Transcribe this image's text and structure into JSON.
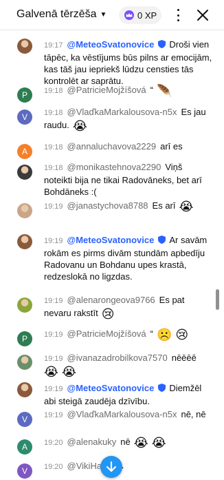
{
  "header": {
    "title": "Galvenā tērzēša",
    "xp_label": "0 XP",
    "xp_icon": "crown-icon",
    "menu_icon": "more-vert-icon",
    "close_icon": "close-icon",
    "accent": "#7c4dff"
  },
  "messages": [
    {
      "avatar_type": "photo",
      "avatar_color": "#8b5a3c",
      "time": "19:17",
      "author": "@MeteoSvatonovice",
      "owner": true,
      "verified": true,
      "text": "Droši vien tāpēc, ka vēstījums būs pilns ar emocijām, kas tāš jau iepriekš lūdzu censties tās kontrolēt ar saprātu.",
      "emoji": ""
    },
    {
      "avatar_type": "letter",
      "avatar_letter": "P",
      "avatar_color": "#2e7d52",
      "time": "19:18",
      "author": "@PatricieMojžíšová",
      "owner": false,
      "verified": false,
      "text": "“",
      "emoji": "🪶"
    },
    {
      "avatar_type": "letter",
      "avatar_letter": "V",
      "avatar_color": "#5c6bc0",
      "time": "19:18",
      "author": "@VlaďkaMarkalousova-n5x",
      "owner": false,
      "verified": false,
      "text": "Es jau raudu.",
      "emoji": "😭"
    },
    {
      "avatar_type": "letter",
      "avatar_letter": "A",
      "avatar_color": "#f4802c",
      "time": "19:18",
      "author": "@annaluchavova2229",
      "owner": false,
      "verified": false,
      "text": "arī es",
      "emoji": ""
    },
    {
      "avatar_type": "photo",
      "avatar_color": "#3b3b3b",
      "time": "19:18",
      "author": "@monikastehnova2290",
      "owner": false,
      "verified": false,
      "text": "Viņš noteikti bija ne tikai Radovāneks, bet arī Bohdāneks :(",
      "emoji": ""
    },
    {
      "avatar_type": "photo",
      "avatar_color": "#c9a68a",
      "time": "19:19",
      "author": "@janastychova8788",
      "owner": false,
      "verified": false,
      "text": "Es arī",
      "emoji": "😭"
    },
    {
      "avatar_type": "photo",
      "avatar_color": "#8b5a3c",
      "time": "19:19",
      "author": "@MeteoSvatonovice",
      "owner": true,
      "verified": true,
      "text": "Ar savām rokām es pirms divām stundām apbedīju Radovanu un Bohdanu upes krastā, redzeslokā no ligzdas.",
      "emoji": ""
    },
    {
      "avatar_type": "photo",
      "avatar_color": "#8aa63a",
      "time": "19:19",
      "author": "@alenarongeova9766",
      "owner": false,
      "verified": false,
      "text": "Es pat nevaru rakstīt",
      "emoji": "😢"
    },
    {
      "avatar_type": "letter",
      "avatar_letter": "P",
      "avatar_color": "#2e7d52",
      "time": "19:19",
      "author": "@PatricieMojžíšová",
      "owner": false,
      "verified": false,
      "text": "“",
      "emoji": "☹️ 😢"
    },
    {
      "avatar_type": "photo",
      "avatar_color": "#6a8f6a",
      "time": "19:19",
      "author": "@ivanazadrobilkova7570",
      "owner": false,
      "verified": false,
      "text": "nēēēē",
      "emoji": "😭 😭"
    },
    {
      "avatar_type": "photo",
      "avatar_color": "#8b5a3c",
      "time": "19:19",
      "author": "@MeteoSvatonovice",
      "owner": true,
      "verified": true,
      "text": "Diemžēl abi steigā zaudēja dzīvību.",
      "emoji": ""
    },
    {
      "avatar_type": "letter",
      "avatar_letter": "V",
      "avatar_color": "#5c6bc0",
      "time": "19:19",
      "author": "@VlaďkaMarkalousova-n5x",
      "owner": false,
      "verified": false,
      "text": "nē, nē",
      "emoji": ""
    },
    {
      "avatar_type": "letter",
      "avatar_letter": "A",
      "avatar_color": "#2e8b6e",
      "time": "19:20",
      "author": "@alenakuky",
      "owner": false,
      "verified": false,
      "text": "nē",
      "emoji": "😭 😭"
    },
    {
      "avatar_type": "letter",
      "avatar_letter": "V",
      "avatar_color": "#7e57c2",
      "time": "19:20",
      "author": "@VikiHa",
      "owner": false,
      "verified": false,
      "text": "",
      "emoji": "😭"
    }
  ],
  "scroll_button_icon": "arrow-down-icon"
}
